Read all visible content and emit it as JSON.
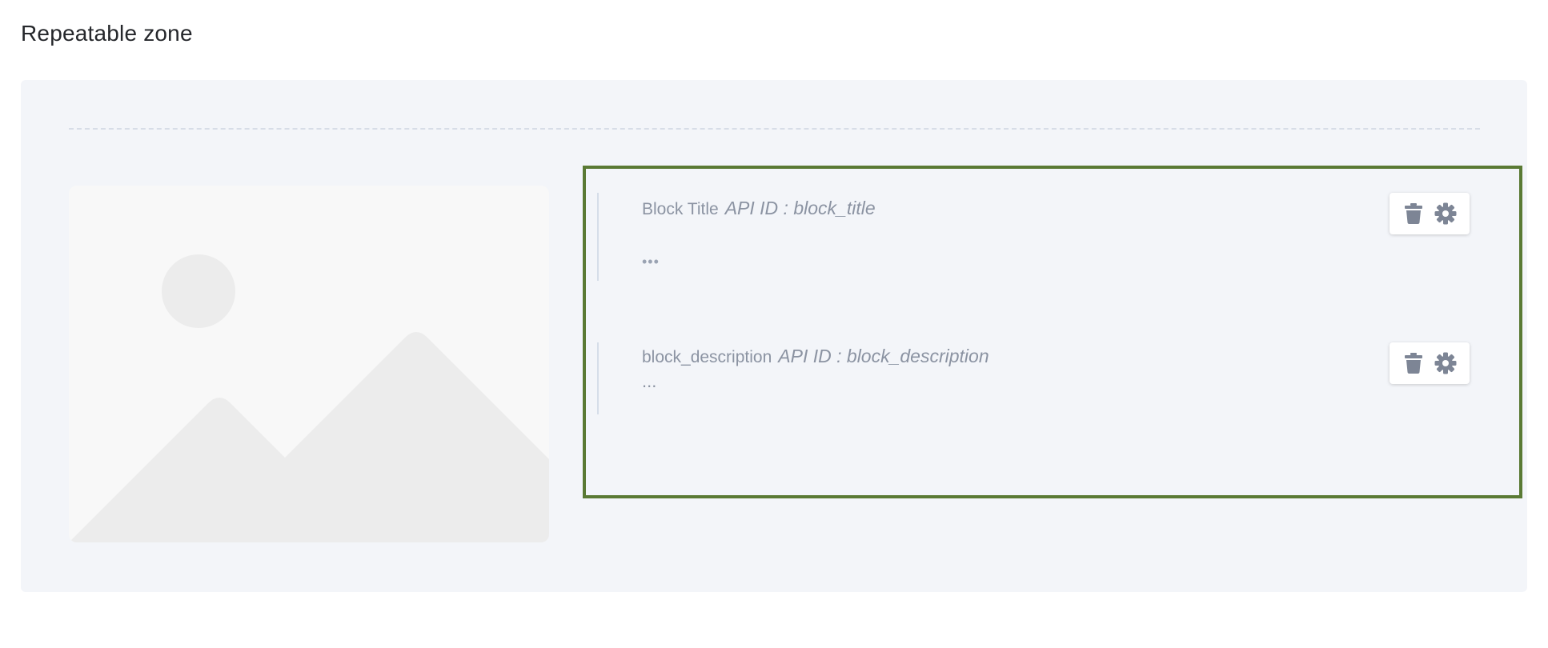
{
  "section": {
    "title": "Repeatable zone"
  },
  "fields": [
    {
      "name": "Block Title",
      "api_id": "API ID : block_title",
      "value": "•••"
    },
    {
      "name": "block_description",
      "api_id": "API ID : block_description",
      "value": "..."
    }
  ],
  "icons": {
    "delete": "trash-icon",
    "settings": "gear-icon",
    "placeholder": "image-placeholder-icon"
  },
  "colors": {
    "zone_background": "#f3f5f9",
    "selection_border": "#5a7a34",
    "label_text": "#8b93a2",
    "icon": "#7d8595"
  }
}
